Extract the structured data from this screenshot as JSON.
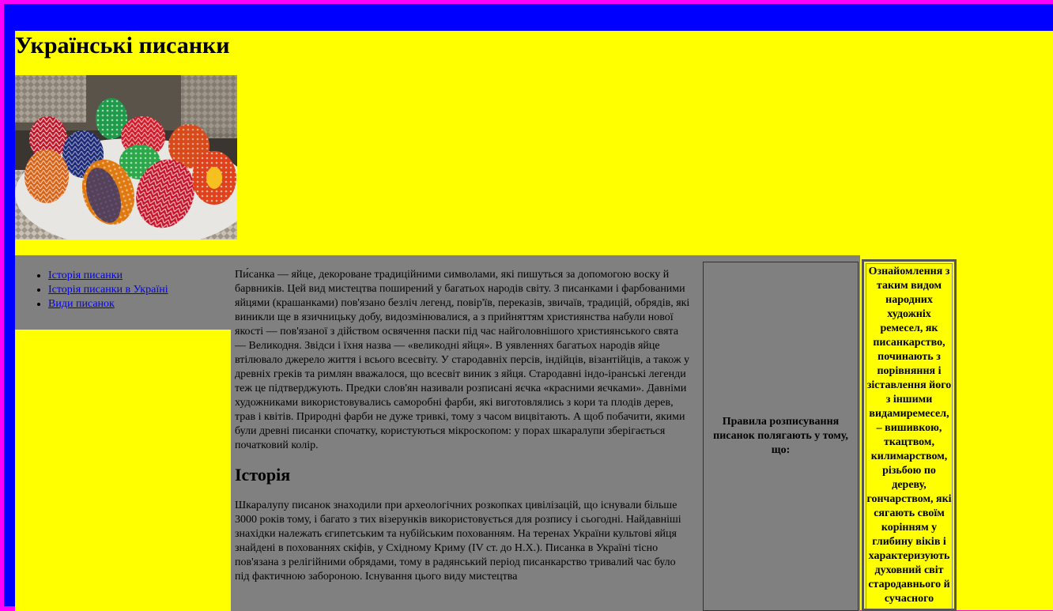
{
  "header": {
    "title": "Українські писанки"
  },
  "hero_image": {
    "alt": "Писанки"
  },
  "nav": {
    "items": [
      {
        "label": "Історія писанки"
      },
      {
        "label": "Історія писанки в Україні"
      },
      {
        "label": "Види писанок"
      }
    ]
  },
  "article": {
    "intro": "Пи́санка — яйце, декороване традиційними символами, які пишуться за допомогою воску й барвників. Цей вид мистецтва поширений у багатьох народів світу. З писанками і фарбованими яйцями (крашанками) пов'язано безліч легенд, повір'їв, переказів, звичаїв, традицій, обрядів, які виникли ще в язичницьку добу, видозмінювалися, а з прийняттям християнства набули нової якості — пов'язаної з дійством освячення паски під час найголовнішого християнського свята — Великодня. Звідси і їхня назва — «великодні яйця». В уявленнях багатьох народів яйце втілювало джерело життя і всього всесвіту. У стародавніх персів, індійців, візантійців, а також у древніх греків та римлян вважалося, що всесвіт виник з яйця. Стародавні індо-іранські легенди теж це підтверджують. Предки слов'ян називали розписані яєчка «красними яєчками». Давніми художниками використовувались саморобні фарби, які виготовлялись з кори та плодів дерев, трав і квітів. Природні фарби не дуже тривкі, тому з часом вицвітають. А щоб побачити, якими були древні писанки спочатку, користуються мікроскопом: у порах шкаралупи зберігається початковий колір.",
    "history_heading": "Історія",
    "history_text": "Шкаралупу писанок знаходили при археологічних розкопках цивілізацій, що існували більше 3000 років тому, і багато з тих візерунків використовується для розпису і сьогодні. Найдавніші знахідки належать єгипетським та нубійським похованням. На теренах України культові яйця знайдені в похованнях скіфів, у Східному Криму (IV ст. до Н.Х.). Писанка в Україні тісно пов'язана з релігійними обрядами, тому в радянський період писанкарство тривалий час було під фактичною забороною. Існування цього виду мистецтва"
  },
  "rules_cell": {
    "text": "Правила розписування писанок полягають у тому, що:"
  },
  "crafts_cell": {
    "text": "Ознайомлення з таким видом народних художніх ремесел, як писанкарство, починають з порівняння і зіставлення його з іншими видамиремесел, – вишивкою, ткацтвом, килимарством, різьбою по дереву, гончарством, які сягають своїм корінням у глибину віків і характеризують духовний світ стародавнього й сучасного українця."
  },
  "colors": {
    "page_background": "#ffff00",
    "outer_border": "#ff00ff",
    "frame": "#0000ff",
    "content_band": "#808080",
    "link": "#0000ee"
  }
}
